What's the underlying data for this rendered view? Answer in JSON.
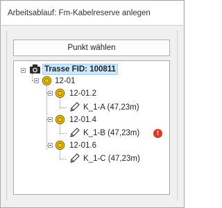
{
  "window": {
    "title": "Arbeitsablauf: Fm-Kabelreserve anlegen"
  },
  "toolbar": {
    "select_point_label": "Punkt wählen"
  },
  "tree": {
    "root": {
      "label": "Trasse FID: 100811",
      "icon": "camera-node-icon"
    },
    "level1": {
      "label": "12-01",
      "icon": "yellow-point-icon"
    },
    "children": [
      {
        "label": "12-01.2",
        "icon": "yellow-point-icon",
        "leaf": {
          "label": "K_1-A (47,23m)",
          "icon": "pencil-icon",
          "error": false
        }
      },
      {
        "label": "12-01.4",
        "icon": "yellow-point-icon",
        "leaf": {
          "label": "K_1-B (47,23m)",
          "icon": "pencil-icon",
          "error": true
        }
      },
      {
        "label": "12-01.6",
        "icon": "yellow-point-icon",
        "leaf": {
          "label": "K_1-C (47,23m)",
          "icon": "pencil-icon",
          "error": false
        }
      }
    ]
  },
  "status": {
    "error_glyph": "!"
  },
  "colors": {
    "selection": "#cce8ff",
    "error": "#d83b1f",
    "point": "#f2c200"
  }
}
